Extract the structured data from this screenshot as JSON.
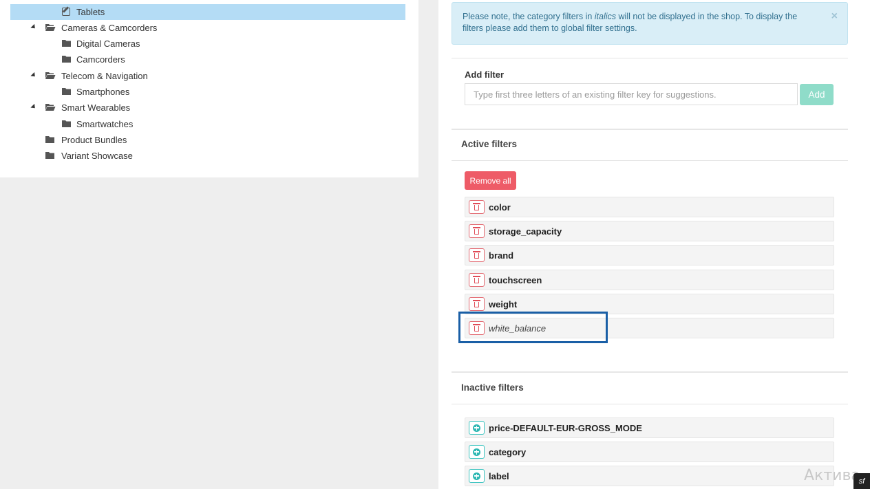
{
  "tree": {
    "items": [
      {
        "label": "Tablets",
        "type": "edit",
        "selected": true
      },
      {
        "label": "Cameras & Camcorders",
        "type": "folder-open",
        "expanded": true
      },
      {
        "label": "Digital Cameras",
        "type": "folder"
      },
      {
        "label": "Camcorders",
        "type": "folder"
      },
      {
        "label": "Telecom & Navigation",
        "type": "folder-open",
        "expanded": true
      },
      {
        "label": "Smartphones",
        "type": "folder"
      },
      {
        "label": "Smart Wearables",
        "type": "folder-open",
        "expanded": true
      },
      {
        "label": "Smartwatches",
        "type": "folder"
      },
      {
        "label": "Product Bundles",
        "type": "folder"
      },
      {
        "label": "Variant Showcase",
        "type": "folder"
      }
    ]
  },
  "alert": {
    "text_before": "Please note, the category filters in ",
    "text_italic": "italics",
    "text_after": " will not be displayed in the shop. To display the filters please add them to global filter settings.",
    "close_symbol": "×"
  },
  "add_filter": {
    "label": "Add filter",
    "placeholder": "Type first three letters of an existing filter key for suggestions.",
    "value": "",
    "button_label": "Add"
  },
  "active_filters": {
    "title": "Active filters",
    "remove_all_label": "Remove all",
    "items": [
      {
        "label": "color",
        "italic": false
      },
      {
        "label": "storage_capacity",
        "italic": false
      },
      {
        "label": "brand",
        "italic": false
      },
      {
        "label": "touchscreen",
        "italic": false
      },
      {
        "label": "weight",
        "italic": false
      },
      {
        "label": "white_balance",
        "italic": true
      }
    ]
  },
  "inactive_filters": {
    "title": "Inactive filters",
    "items": [
      {
        "label": "price-DEFAULT-EUR-GROSS_MODE"
      },
      {
        "label": "category"
      },
      {
        "label": "label"
      }
    ]
  },
  "watermark": "Актива",
  "badge": "sf",
  "colors": {
    "selected_row": "#b4dcf5",
    "alert_bg": "#d9eef7",
    "alert_text": "#31708f",
    "add_button": "#8fdcc9",
    "remove_all": "#ee5b67",
    "delete_icon": "#e04b57",
    "add_icon": "#2eb7b3",
    "highlight_box": "#1a5fa6"
  },
  "icons": {
    "edit": "pencil-square-icon",
    "folder": "folder-icon",
    "folder-open": "folder-open-icon",
    "delete": "trash-icon",
    "add": "plus-circle-icon"
  }
}
